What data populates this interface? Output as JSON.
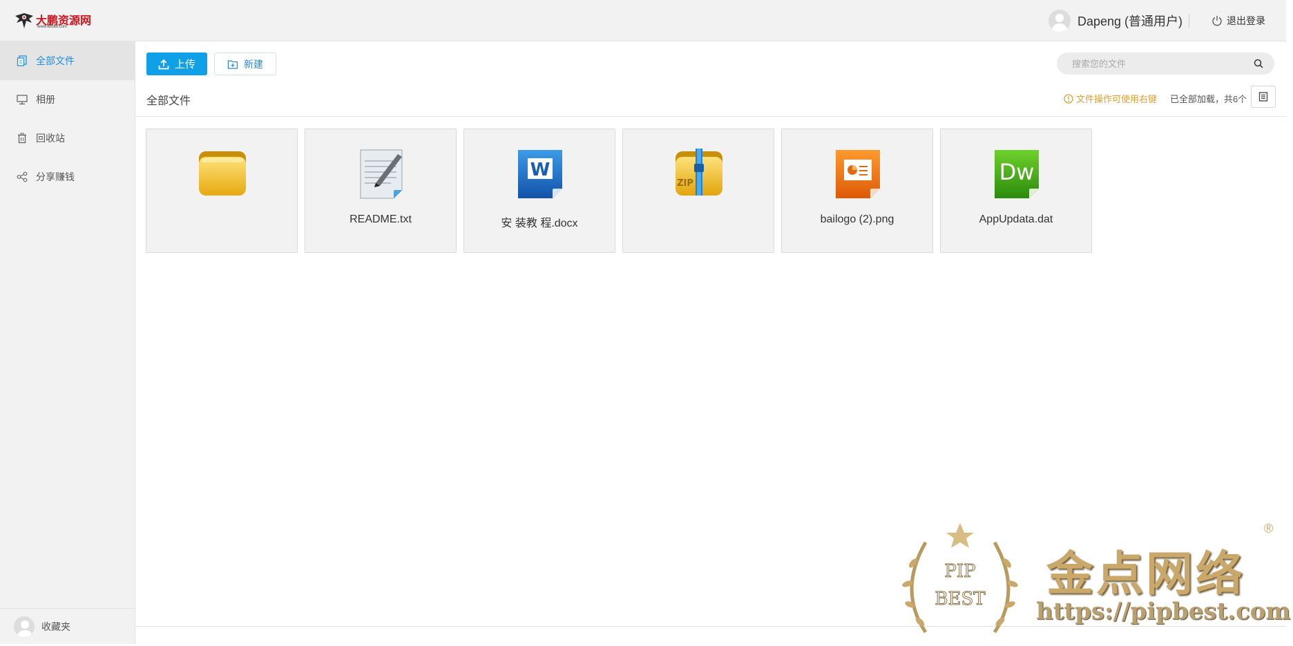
{
  "header": {
    "logo_text": "大鹏资源网",
    "logo_sub": "www.wzddt.com",
    "user_name": "Dapeng (普通用户)",
    "logout_label": "退出登录"
  },
  "sidebar": {
    "items": [
      {
        "label": "全部文件",
        "icon": "files-icon",
        "active": true
      },
      {
        "label": "相册",
        "icon": "monitor-icon",
        "active": false
      },
      {
        "label": "回收站",
        "icon": "trash-icon",
        "active": false
      },
      {
        "label": "分享赚钱",
        "icon": "share-icon",
        "active": false
      }
    ],
    "footer_label": "收藏夹"
  },
  "toolbar": {
    "upload_label": "上传",
    "new_label": "新建",
    "search_placeholder": "搜索您的文件"
  },
  "main": {
    "breadcrumb": "全部文件",
    "tip": "文件操作可使用右键",
    "loaded_text": "已全部加载，共6个"
  },
  "files": [
    {
      "name": "",
      "type": "folder"
    },
    {
      "name": "README.txt",
      "type": "txt"
    },
    {
      "name": "安 装教 程.docx",
      "type": "docx"
    },
    {
      "name": "",
      "type": "zip"
    },
    {
      "name": "bailogo (2).png",
      "type": "ppt"
    },
    {
      "name": "AppUpdata.dat",
      "type": "dw"
    }
  ],
  "watermark": {
    "title": "金点网络",
    "url": "https://pipbest.com",
    "badge_top": "PIP",
    "badge_bottom": "BEST",
    "reg": "®"
  },
  "colors": {
    "accent": "#0fa0e8",
    "active_text": "#1e8fe1",
    "tip": "#e0a030"
  }
}
